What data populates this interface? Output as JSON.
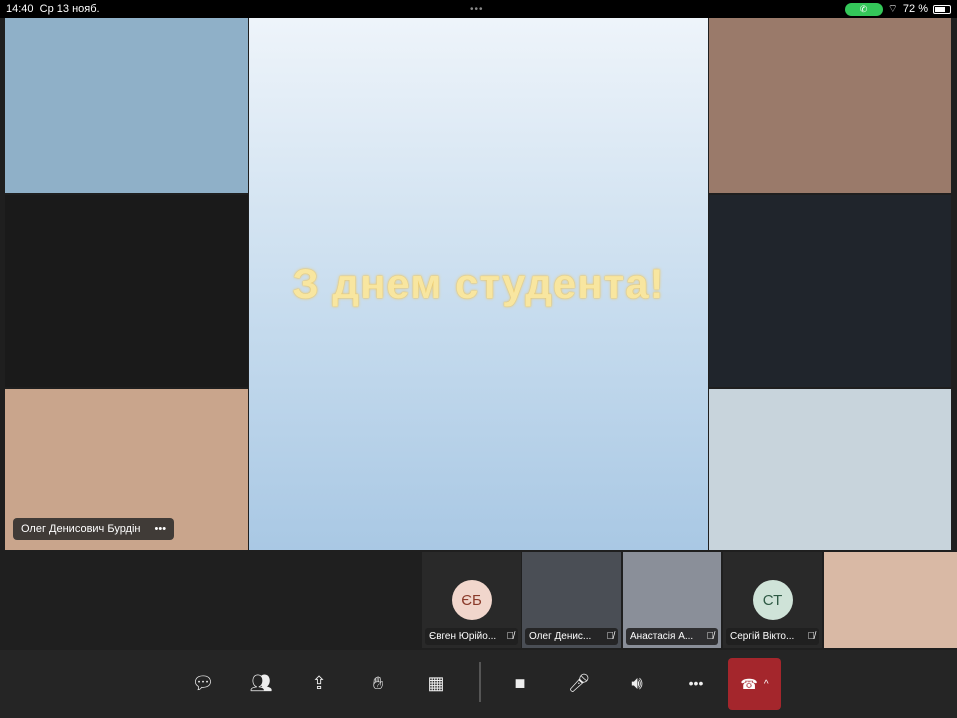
{
  "status_bar": {
    "time": "14:40",
    "date": "Ср 13 нояб.",
    "battery": "72 %",
    "battery_level": 72
  },
  "slide": {
    "title": "З днем студента!"
  },
  "stage_tiles": [
    {
      "name": "chemist-lab-photo",
      "color": "#8fb0c8"
    },
    {
      "name": "chemistry-formulas-photo",
      "color": "#1a1a1a"
    },
    {
      "name": "students-lab-photo",
      "color": "#c9a58c",
      "label": "Олег Денисович Бурдін"
    },
    {
      "name": "lecture-hall-photo",
      "color": "#9a7a6a"
    },
    {
      "name": "scientist-flask-photo",
      "color": "#20252c"
    },
    {
      "name": "student-girl-photo",
      "color": "#c8d4dc"
    }
  ],
  "participants": [
    {
      "initials": "ЄБ",
      "name": "Євген Юрійо...",
      "avatar_color": "#f1d6cc",
      "text_color": "#8a3a2a"
    },
    {
      "name": "Олег Денис...",
      "video_color": "#4a4e55"
    },
    {
      "name": "Анастасія А...",
      "video_color": "#8a8f99"
    },
    {
      "initials": "СТ",
      "name": "Сергій Вікто...",
      "avatar_color": "#cfe3d8",
      "text_color": "#2e5a44"
    },
    {
      "name": "",
      "video_color": "#d9b9a5"
    }
  ],
  "toolbar": {
    "more": "•••",
    "chevron": "^"
  }
}
